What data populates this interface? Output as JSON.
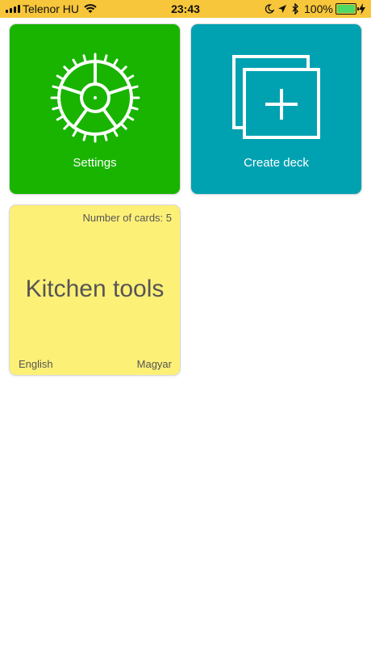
{
  "status_bar": {
    "carrier": "Telenor HU",
    "time": "23:43",
    "battery_percent": "100%",
    "battery_level": 1.0,
    "icons": [
      "signal-icon",
      "wifi-icon",
      "moon-icon",
      "location-icon",
      "bluetooth-icon",
      "battery-icon",
      "charging-icon"
    ]
  },
  "tiles": {
    "settings": {
      "label": "Settings",
      "color": "#18b400",
      "icon": "gear-icon"
    },
    "create_deck": {
      "label": "Create deck",
      "color": "#00a1b1",
      "icon": "add-deck-icon"
    }
  },
  "decks": [
    {
      "title": "Kitchen tools",
      "count_text": "Number of cards: 5",
      "source_language": "English",
      "target_language": "Magyar",
      "color": "#fdf077"
    }
  ]
}
